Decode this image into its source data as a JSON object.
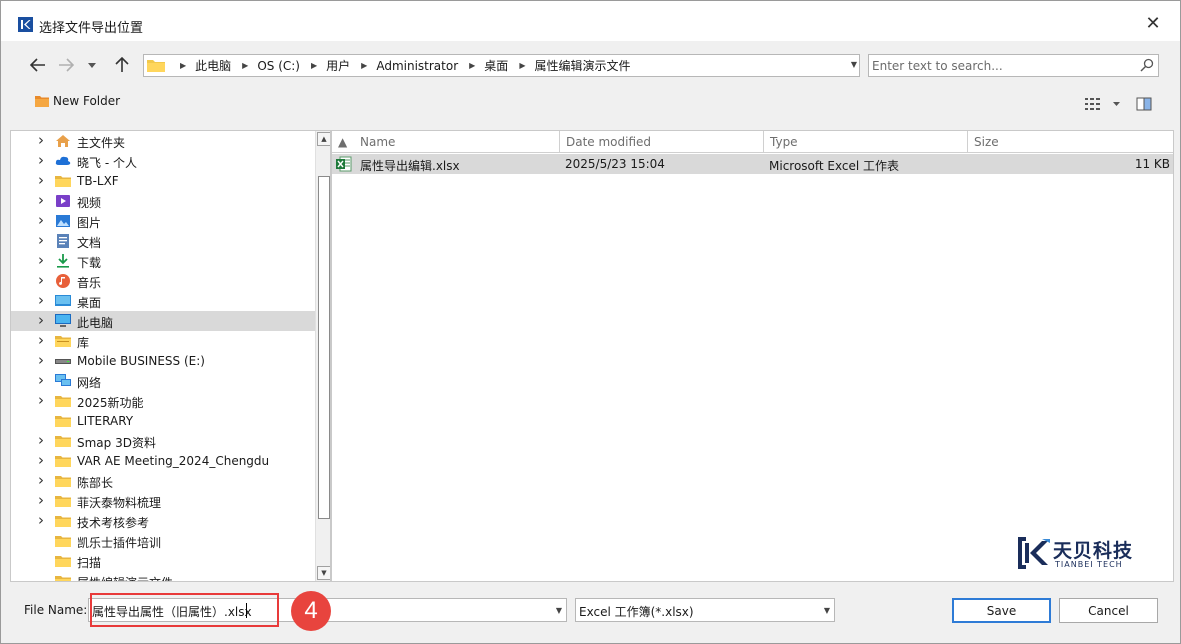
{
  "window": {
    "title": "选择文件导出位置",
    "close_label": "✕"
  },
  "nav": {
    "back_icon": "arrow-left-icon",
    "forward_icon": "arrow-right-icon",
    "recent_icon": "chevron-down-icon",
    "up_icon": "arrow-up-icon"
  },
  "address": {
    "crumbs": [
      "此电脑",
      "OS (C:)",
      "用户",
      "Administrator",
      "桌面",
      "属性编辑演示文件"
    ]
  },
  "search": {
    "placeholder": "Enter text to search..."
  },
  "toolbar": {
    "new_folder_label": "New Folder"
  },
  "tree": {
    "items": [
      {
        "label": "主文件夹",
        "icon": "home-icon",
        "expandable": true
      },
      {
        "label": "晓飞 - 个人",
        "icon": "cloud-icon",
        "expandable": true
      },
      {
        "label": "TB-LXF",
        "icon": "folder-icon",
        "expandable": true
      },
      {
        "label": "视频",
        "icon": "video-icon",
        "expandable": true
      },
      {
        "label": "图片",
        "icon": "picture-icon",
        "expandable": true
      },
      {
        "label": "文档",
        "icon": "document-icon",
        "expandable": true
      },
      {
        "label": "下载",
        "icon": "download-icon",
        "expandable": true
      },
      {
        "label": "音乐",
        "icon": "music-icon",
        "expandable": true
      },
      {
        "label": "桌面",
        "icon": "desktop-icon",
        "expandable": true
      },
      {
        "label": "此电脑",
        "icon": "computer-icon",
        "expandable": true,
        "selected": true
      },
      {
        "label": "库",
        "icon": "library-icon",
        "expandable": true
      },
      {
        "label": "Mobile BUSINESS (E:)",
        "icon": "drive-icon",
        "expandable": true
      },
      {
        "label": "网络",
        "icon": "network-icon",
        "expandable": true
      },
      {
        "label": "2025新功能",
        "icon": "folder-icon",
        "expandable": true
      },
      {
        "label": "LITERARY",
        "icon": "folder-icon",
        "expandable": false
      },
      {
        "label": "Smap 3D资料",
        "icon": "folder-icon",
        "expandable": true
      },
      {
        "label": "VAR AE Meeting_2024_Chengdu",
        "icon": "folder-icon",
        "expandable": true
      },
      {
        "label": "陈部长",
        "icon": "folder-icon",
        "expandable": true
      },
      {
        "label": "菲沃泰物料梳理",
        "icon": "folder-icon",
        "expandable": true
      },
      {
        "label": "技术考核参考",
        "icon": "folder-icon",
        "expandable": true
      },
      {
        "label": "凯乐士插件培训",
        "icon": "folder-icon",
        "expandable": false
      },
      {
        "label": "扫描",
        "icon": "folder-icon",
        "expandable": false
      },
      {
        "label": "属性编辑演示文件",
        "icon": "folder-icon",
        "expandable": false
      }
    ]
  },
  "files": {
    "columns": [
      "Name",
      "Date modified",
      "Type",
      "Size"
    ],
    "rows": [
      {
        "name": "属性导出编辑.xlsx",
        "modified": "2025/5/23 15:04",
        "type": "Microsoft Excel 工作表",
        "size": "11 KB"
      }
    ]
  },
  "brand": {
    "name": "天贝科技",
    "sub": "TIANBEI TECH"
  },
  "bottom": {
    "file_name_label": "File Name:",
    "file_name_value": "属性导出属性（旧属性）.xlsx",
    "file_type_value": "Excel 工作簿(*.xlsx)",
    "save_label": "Save",
    "cancel_label": "Cancel",
    "step_number": "4"
  },
  "colors": {
    "accent": "#2e7bd6",
    "highlight": "#e83a3a",
    "selection": "#d9d9d9"
  }
}
